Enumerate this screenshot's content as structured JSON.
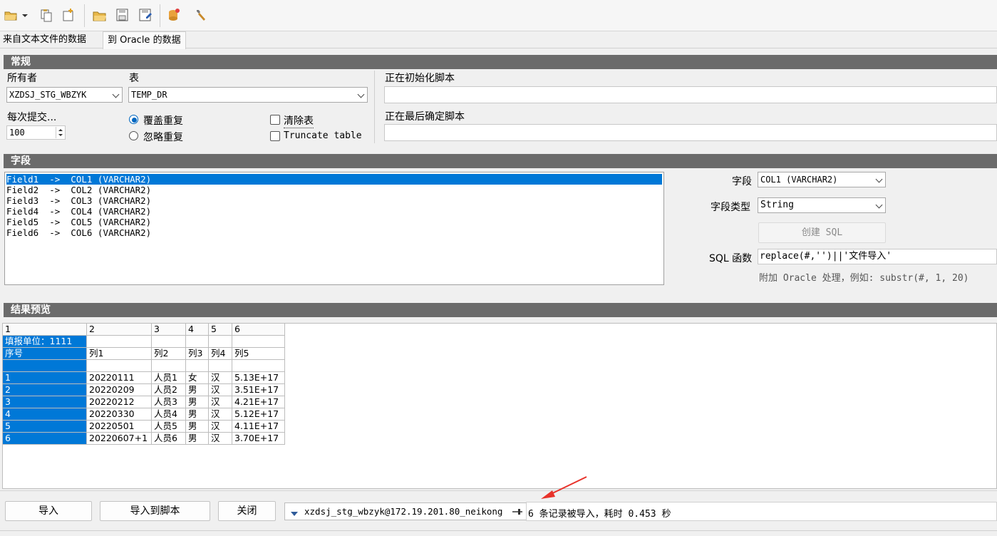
{
  "toolbar": {
    "icons": [
      "open-folder-dropdown-icon",
      "copy-icon",
      "new-icon",
      "open-icon",
      "save-icon",
      "save-as-icon",
      "db-import-icon",
      "wrench-icon"
    ]
  },
  "tabs": [
    {
      "label": "来自文本文件的数据"
    },
    {
      "label": "到 Oracle 的数据"
    }
  ],
  "general": {
    "header": "常规",
    "owner_label": "所有者",
    "owner_value": "XZDSJ_STG_WBZYK",
    "table_label": "表",
    "table_value": "TEMP_DR",
    "commit_label": "每次提交...",
    "commit_value": "100",
    "radio_overwrite": "覆盖重复",
    "radio_ignore": "忽略重复",
    "chk_clear": "清除表",
    "chk_truncate": "Truncate table",
    "init_script_label": "正在初始化脚本",
    "final_script_label": "正在最后确定脚本"
  },
  "fields": {
    "header": "字段",
    "rows": [
      "Field1  ->  COL1 (VARCHAR2)",
      "Field2  ->  COL2 (VARCHAR2)",
      "Field3  ->  COL3 (VARCHAR2)",
      "Field4  ->  COL4 (VARCHAR2)",
      "Field5  ->  COL5 (VARCHAR2)",
      "Field6  ->  COL6 (VARCHAR2)"
    ],
    "field_label": "字段",
    "field_value": "COL1 (VARCHAR2)",
    "type_label": "字段类型",
    "type_value": "String",
    "create_sql": "创建 SQL",
    "sql_func_label": "SQL 函数",
    "sql_func_value": "replace(#,'')||'文件导入'",
    "hint": "附加 Oracle 处理，例如: substr(#, 1, 20)"
  },
  "preview": {
    "header": "结果预览",
    "columns": [
      "1",
      "2",
      "3",
      "4",
      "5",
      "6"
    ],
    "rows": [
      [
        "填报单位：1111",
        "",
        "",
        "",
        "",
        ""
      ],
      [
        "序号",
        "列1",
        "列2",
        "列3",
        "列4",
        "列5"
      ],
      [
        "",
        "",
        "",
        "",
        "",
        ""
      ],
      [
        "1",
        "20220111",
        "人员1",
        "女",
        "汉",
        "5.13E+17"
      ],
      [
        "2",
        "20220209",
        "人员2",
        "男",
        "汉",
        "3.51E+17"
      ],
      [
        "3",
        "20220212",
        "人员3",
        "男",
        "汉",
        "4.21E+17"
      ],
      [
        "4",
        "20220330",
        "人员4",
        "男",
        "汉",
        "5.12E+17"
      ],
      [
        "5",
        "20220501",
        "人员5",
        "男",
        "汉",
        "4.11E+17"
      ],
      [
        "6",
        "20220607+1",
        "人员6",
        "男",
        "汉",
        "3.70E+17"
      ]
    ]
  },
  "bottom": {
    "import": "导入",
    "import_script": "导入到脚本",
    "close": "关闭",
    "connection": "xzdsj_stg_wbzyk@172.19.201.80_neikong",
    "status": "6 条记录被导入，耗时 0.453 秒"
  },
  "colors": {
    "selection": "#0078d7",
    "section_header": "#6b6b6b",
    "annotation_arrow": "#e8322a"
  }
}
